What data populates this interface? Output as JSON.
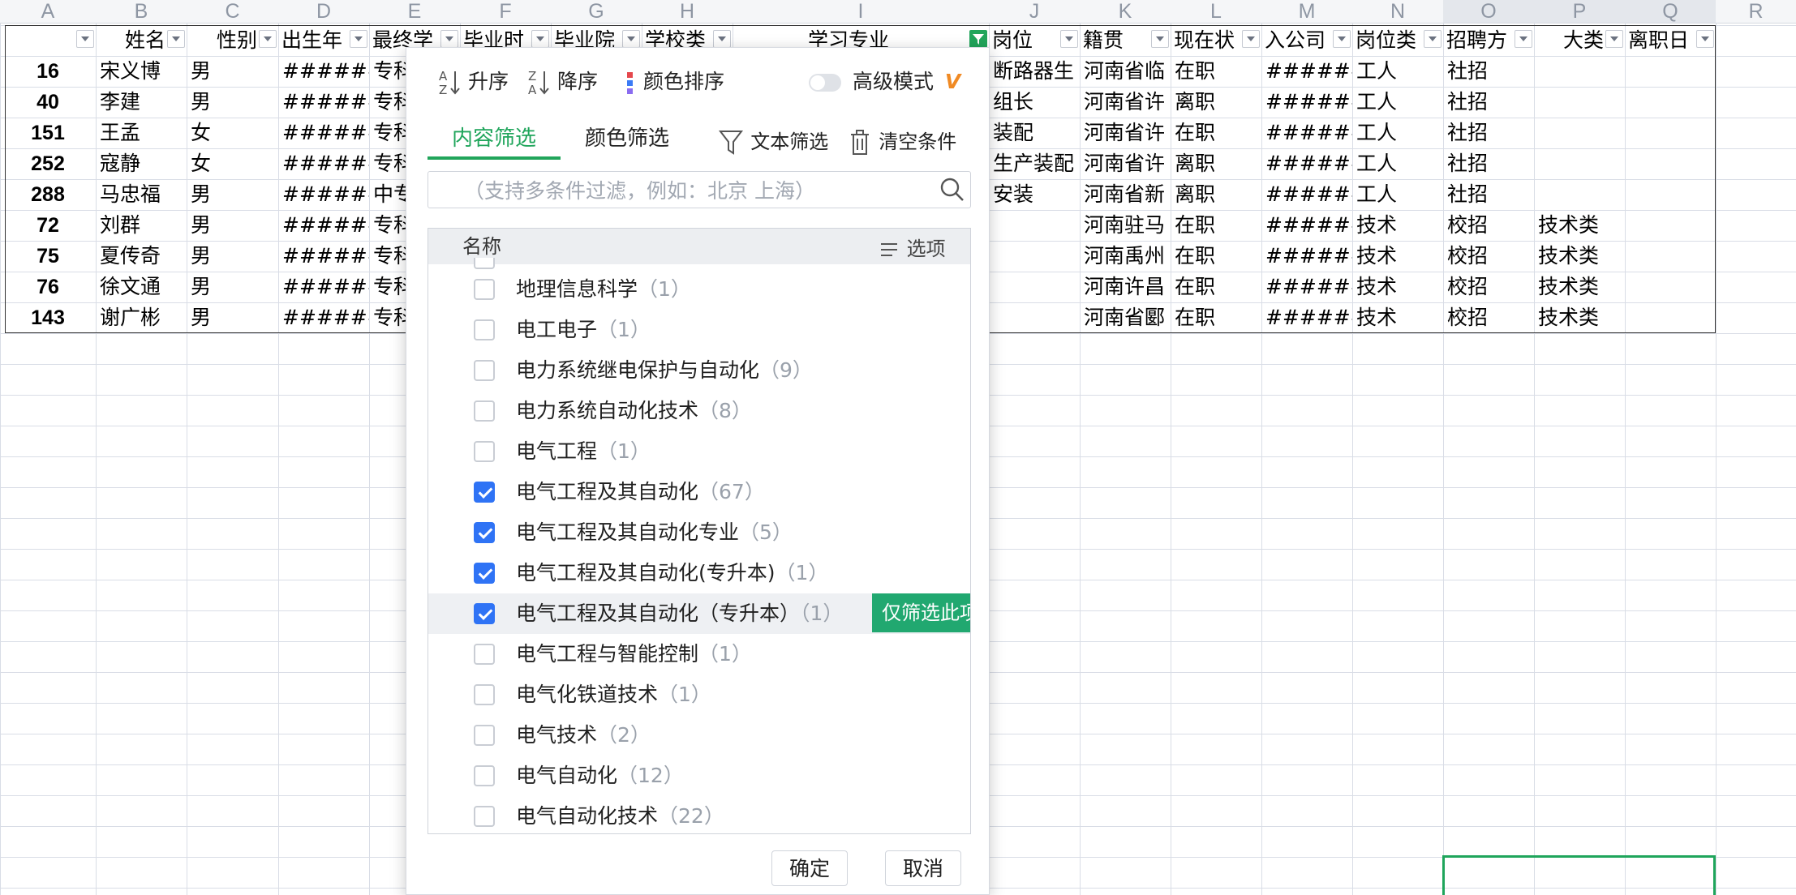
{
  "columns": [
    "A",
    "B",
    "C",
    "D",
    "E",
    "F",
    "G",
    "H",
    "I",
    "J",
    "K",
    "L",
    "M",
    "N",
    "O",
    "P",
    "Q",
    "R"
  ],
  "selected_columns": [
    "O",
    "P",
    "Q"
  ],
  "headers": [
    "",
    "姓名",
    "性别",
    "出生年",
    "最终学",
    "毕业时",
    "毕业院",
    "学校类",
    "学习专业",
    "岗位",
    "籍贯",
    "现在状",
    "入公司",
    "岗位类",
    "招聘方",
    "大类",
    "离职日"
  ],
  "filter_active_column": "I",
  "rows": [
    [
      "16",
      "宋义博",
      "男",
      "######",
      "专科",
      "",
      "",
      "",
      "",
      "断路器生",
      "河南省临",
      "在职",
      "######",
      "工人",
      "社招",
      "",
      ""
    ],
    [
      "40",
      "李建",
      "男",
      "######",
      "专科",
      "",
      "",
      "",
      "",
      "组长",
      "河南省许",
      "离职",
      "######",
      "工人",
      "社招",
      "",
      ""
    ],
    [
      "151",
      "王孟",
      "女",
      "######",
      "专科",
      "",
      "",
      "",
      "",
      "装配",
      "河南省许",
      "在职",
      "######",
      "工人",
      "社招",
      "",
      ""
    ],
    [
      "252",
      "寇静",
      "女",
      "######",
      "专科",
      "",
      "",
      "",
      "",
      "生产装配",
      "河南省许",
      "离职",
      "######",
      "工人",
      "社招",
      "",
      ""
    ],
    [
      "288",
      "马忠福",
      "男",
      "######",
      "中专",
      "",
      "",
      "",
      "",
      "安装",
      "河南省新",
      "离职",
      "######",
      "工人",
      "社招",
      "",
      ""
    ],
    [
      "72",
      "刘群",
      "男",
      "######",
      "专科",
      "",
      "",
      "",
      "",
      "",
      "河南驻马",
      "在职",
      "######",
      "技术",
      "校招",
      "技术类",
      ""
    ],
    [
      "75",
      "夏传奇",
      "男",
      "######",
      "专科",
      "",
      "",
      "",
      "",
      "",
      "河南禹州",
      "在职",
      "######",
      "技术",
      "校招",
      "技术类",
      ""
    ],
    [
      "76",
      "徐文通",
      "男",
      "######",
      "专科",
      "",
      "",
      "",
      "",
      "",
      "河南许昌",
      "在职",
      "######",
      "技术",
      "校招",
      "技术类",
      ""
    ],
    [
      "143",
      "谢广彬",
      "男",
      "######",
      "专科",
      "",
      "",
      "",
      "",
      "",
      "河南省郾",
      "在职",
      "######",
      "技术",
      "校招",
      "技术类",
      ""
    ]
  ],
  "filter_dialog": {
    "toolbar": {
      "asc": "升序",
      "desc": "降序",
      "color_sort": "颜色排序",
      "advanced": "高级模式"
    },
    "tabs": {
      "content": "内容筛选",
      "color": "颜色筛选",
      "text_filter": "文本筛选",
      "clear": "清空条件"
    },
    "search_placeholder": "（支持多条件过滤，例如：北京 上海）",
    "list_header": {
      "name": "名称",
      "options": "选项"
    },
    "items": [
      {
        "label": "地理信息科学",
        "count": "（1）",
        "checked": false
      },
      {
        "label": "电工电子",
        "count": "（1）",
        "checked": false
      },
      {
        "label": "电力系统继电保护与自动化",
        "count": "（9）",
        "checked": false
      },
      {
        "label": "电力系统自动化技术",
        "count": "（8）",
        "checked": false
      },
      {
        "label": "电气工程",
        "count": "（1）",
        "checked": false
      },
      {
        "label": "电气工程及其自动化",
        "count": "（67）",
        "checked": true
      },
      {
        "label": "电气工程及其自动化专业",
        "count": "（5）",
        "checked": true
      },
      {
        "label": "电气工程及其自动化(专升本)",
        "count": "（1）",
        "checked": true
      },
      {
        "label": "电气工程及其自动化（专升本）",
        "count": "（1）",
        "checked": true
      },
      {
        "label": "电气工程与智能控制",
        "count": "（1）",
        "checked": false
      },
      {
        "label": "电气化铁道技术",
        "count": "（1）",
        "checked": false
      },
      {
        "label": "电气技术",
        "count": "（2）",
        "checked": false
      },
      {
        "label": "电气自动化",
        "count": "（12）",
        "checked": false
      },
      {
        "label": "电气自动化技术",
        "count": "（22）",
        "checked": false
      }
    ],
    "only_this_label": "仅筛选此项",
    "ok_label": "确定",
    "cancel_label": "取消"
  },
  "colors": {
    "accent_green": "#21a55b",
    "checkbox_blue": "#2f73f5"
  }
}
